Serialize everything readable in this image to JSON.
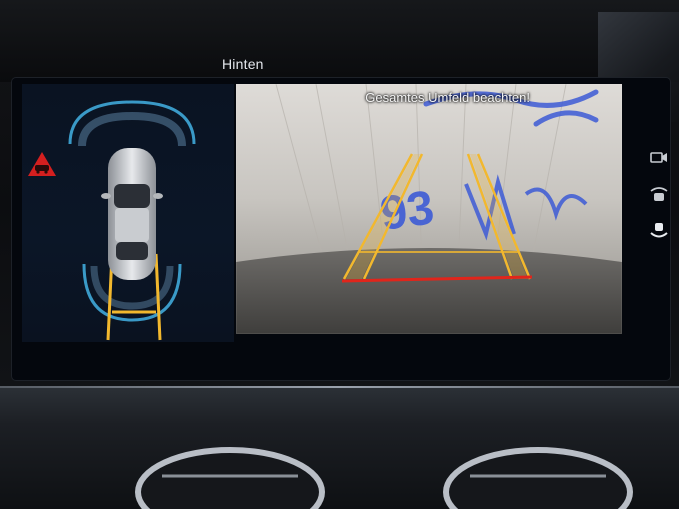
{
  "screen": {
    "title": "Hinten",
    "camera_message": "Gesamtes Umfeld beachten!"
  },
  "graffiti_text": "93",
  "colors": {
    "guide_yellow": "#f2b82e",
    "stop_red": "#e1251b",
    "sensor_blue": "#3fa9d9",
    "warning_red": "#d41f1f"
  },
  "side_icons": [
    "camera-switch-icon",
    "parking-sensor-icon",
    "parking-assist-icon"
  ]
}
